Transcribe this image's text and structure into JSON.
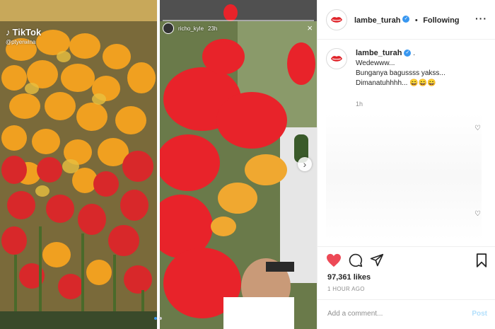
{
  "post": {
    "username": "lambe_turah",
    "verified_badge": "✓",
    "follow_separator": "•",
    "follow_status": "Following",
    "more_icon": "more-options-icon"
  },
  "media": {
    "left_panel": {
      "watermark": "TikTok",
      "handle": "@ptyerwina"
    },
    "right_panel": {
      "story_user": "richo_kyle",
      "story_time": "23h",
      "close_label": "×"
    },
    "next_label": "›"
  },
  "caption": {
    "username": "lambe_turah",
    "verified_badge": "✓",
    "trailing": ".",
    "lines": [
      "Wedewww...",
      "Bunganya bagussss yakss...",
      "Dimanatuhhhh... 😄😄😄"
    ],
    "time": "1h"
  },
  "actions": {
    "like_icon": "heart-filled-icon",
    "comment_icon": "comment-icon",
    "share_icon": "share-icon",
    "save_icon": "bookmark-icon",
    "like_color": "#ed4956"
  },
  "stats": {
    "likes": "97,361 likes",
    "posted": "1 HOUR AGO"
  },
  "comment": {
    "placeholder": "Add a comment...",
    "post_label": "Post"
  },
  "colors": {
    "brand_red": "#e0242a",
    "verified_blue": "#3897f0",
    "post_disabled": "#b2dffc"
  }
}
